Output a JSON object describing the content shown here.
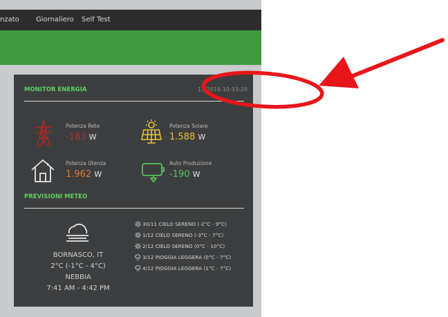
{
  "nav": {
    "items": [
      "nzato",
      "Giornaliero",
      "Self Test"
    ]
  },
  "energy": {
    "title": "MONITOR ENERGIA",
    "timestamp": "11/2016 10:33:29",
    "rete": {
      "label": "Potenza Rete",
      "value": "-183",
      "unit": "W",
      "color": "#b83030"
    },
    "solare": {
      "label": "Potenza Solare",
      "value": "1.588",
      "unit": "W",
      "color": "#e8c23a"
    },
    "utenza": {
      "label": "Potenza Utenza",
      "value": "1.962",
      "unit": "W",
      "color": "#e07a2c"
    },
    "auto": {
      "label": "Auto Produzione",
      "value": "-190",
      "unit": "W",
      "color": "#59c459"
    }
  },
  "weather": {
    "title": "PREVISIONI METEO",
    "city": "BORNASCO, IT",
    "temp": "2°C (-1°C - 4°C)",
    "condition": "NEBBIA",
    "sun": "7:41 AM - 4:42 PM",
    "forecast": [
      {
        "text": "30/11 CIELO SERENO (-2°C - 9°C)",
        "icon": "sun-icon"
      },
      {
        "text": "1/12 CIELO SERENO (-3°C - 7°C)",
        "icon": "sun-icon"
      },
      {
        "text": "2/12 CIELO SERENO (0°C - 10°C)",
        "icon": "sun-icon"
      },
      {
        "text": "3/12 PIOGGIA LEGGERA (0°C - 7°C)",
        "icon": "rain-icon"
      },
      {
        "text": "4/12 PIOGGIA LEGGERA (1°C - 7°C)",
        "icon": "rain-icon"
      }
    ]
  },
  "annotation": {
    "color": "#e8161b"
  }
}
